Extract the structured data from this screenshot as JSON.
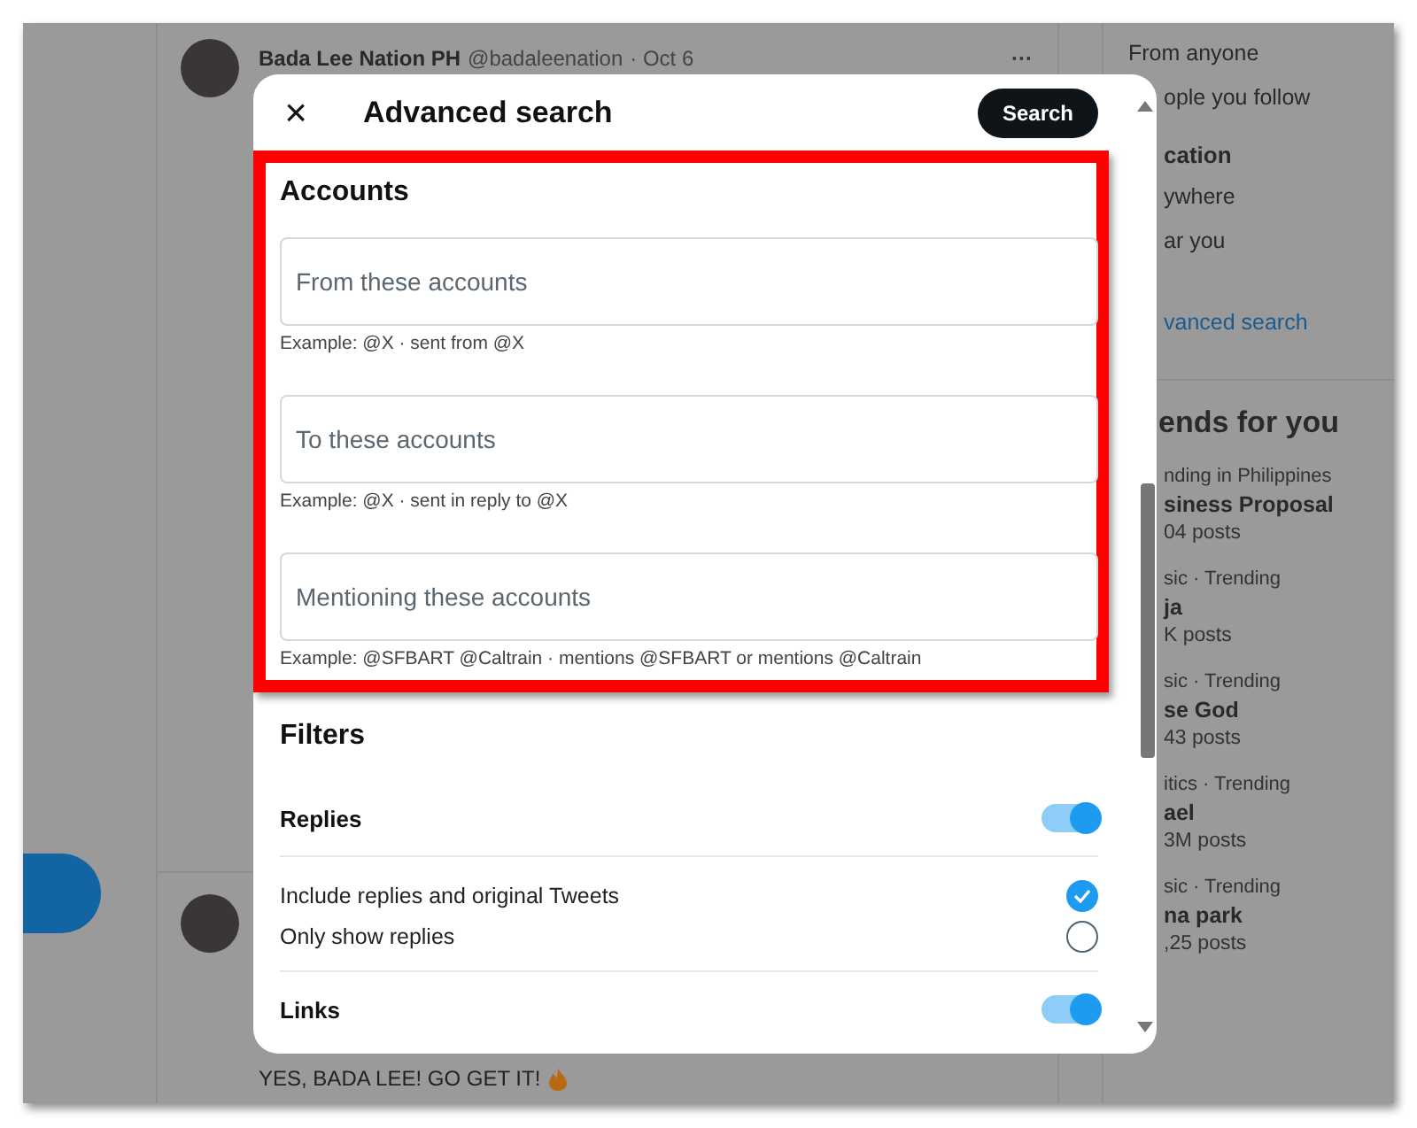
{
  "background": {
    "tweets": [
      {
        "author": "Bada Lee Nation PH",
        "handle": "@badaleenation",
        "date": "· Oct 6",
        "more": "···"
      },
      {
        "text": "YES, BADA LEE! GO GET IT!"
      }
    ],
    "right_panel": {
      "items": [
        {
          "kind": "option",
          "text": "From anyone"
        },
        {
          "kind": "option",
          "text": "ople you follow"
        },
        {
          "kind": "heading",
          "text": "cation"
        },
        {
          "kind": "option",
          "text": "ywhere"
        },
        {
          "kind": "option",
          "text": "ar you"
        },
        {
          "kind": "link",
          "text": "vanced search"
        }
      ],
      "trends_title": "ends for you",
      "trends": [
        {
          "context": "nding in Philippines",
          "name": "siness Proposal",
          "posts": "04 posts"
        },
        {
          "context": "sic · Trending",
          "name": "ja",
          "posts": "K posts"
        },
        {
          "context": "sic · Trending",
          "name": "se God",
          "posts": "43 posts"
        },
        {
          "context": "itics · Trending",
          "name": "ael",
          "posts": "3M posts"
        },
        {
          "context": "sic · Trending",
          "name": "na park",
          "posts": ",25 posts"
        }
      ]
    }
  },
  "modal": {
    "close": "×",
    "title": "Advanced search",
    "search_button": "Search",
    "accounts": {
      "heading": "Accounts",
      "fields": [
        {
          "placeholder": "From these accounts",
          "hint": "Example: @X · sent from @X"
        },
        {
          "placeholder": "To these accounts",
          "hint": "Example: @X · sent in reply to @X"
        },
        {
          "placeholder": "Mentioning these accounts",
          "hint": "Example: @SFBART @Caltrain · mentions @SFBART or mentions @Caltrain"
        }
      ]
    },
    "filters": {
      "heading": "Filters",
      "replies": {
        "label": "Replies",
        "on": true
      },
      "options": [
        {
          "label": "Include replies and original Tweets",
          "selected": true
        },
        {
          "label": "Only show replies",
          "selected": false
        }
      ],
      "links": {
        "label": "Links",
        "on": true
      }
    }
  }
}
